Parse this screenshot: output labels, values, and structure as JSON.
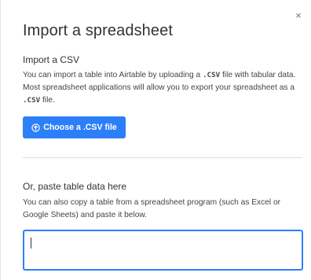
{
  "dialog": {
    "title": "Import a spreadsheet",
    "close_icon": "close-icon",
    "close_glyph": "×"
  },
  "csv_section": {
    "heading": "Import a CSV",
    "desc_part1": "You can import a table into Airtable by uploading a ",
    "desc_code1": ".CSV",
    "desc_part2": " file with tabular data. Most spreadsheet applications will allow you to export your spreadsheet as a ",
    "desc_code2": ".CSV",
    "desc_part3": " file.",
    "button_icon": "upload-icon",
    "button_label": "Choose a .CSV file"
  },
  "paste_section": {
    "heading": "Or, paste table data here",
    "description": "You can also copy a table from a spreadsheet program (such as Excel or Google Sheets) and paste it below.",
    "input_value": "",
    "input_placeholder": ""
  },
  "colors": {
    "accent": "#2d7ff9",
    "text": "#333333",
    "divider": "#dedede"
  }
}
